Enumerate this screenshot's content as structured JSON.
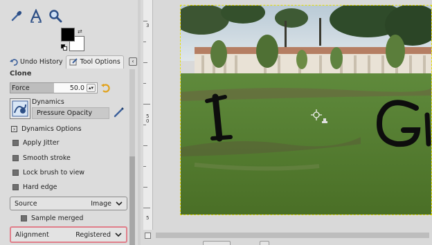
{
  "tabs": [
    {
      "label": "Undo History",
      "icon": "undo-history-icon"
    },
    {
      "label": "Tool Options",
      "icon": "tool-options-icon"
    }
  ],
  "tool_options": {
    "title": "Clone",
    "force": {
      "label": "Force",
      "value": "50.0",
      "fill_fraction": 0.5
    },
    "dynamics": {
      "label": "Dynamics",
      "value": "Pressure Opacity"
    },
    "dynamics_options": {
      "label": "Dynamics Options",
      "expanded": false
    },
    "checkboxes": [
      {
        "label": "Apply Jitter"
      },
      {
        "label": "Smooth stroke"
      },
      {
        "label": "Lock brush to view"
      },
      {
        "label": "Hard edge"
      }
    ],
    "source": {
      "label": "Source",
      "value": "Image"
    },
    "sample_merged": {
      "label": "Sample merged"
    },
    "alignment": {
      "label": "Alignment",
      "value": "Registered"
    }
  },
  "ruler_labels": [
    "3",
    "5\n0",
    "5"
  ],
  "canvas_annotations": [
    "I",
    "G"
  ],
  "colors": {
    "accent_highlight": "#e07e8a",
    "sky": "#c9d6df",
    "grass": "#4e7a2c"
  }
}
